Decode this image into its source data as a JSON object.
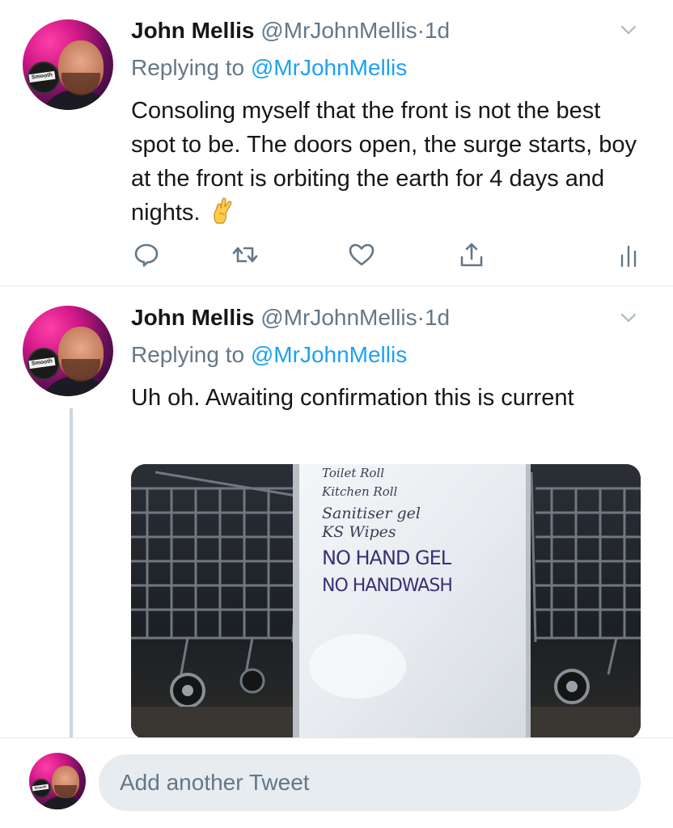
{
  "tweets": [
    {
      "name": "John Mellis",
      "handle": "@MrJohnMellis",
      "separator": "·",
      "time": "1d",
      "replying_prefix": "Replying to ",
      "replying_handle": "@MrJohnMellis",
      "text": "Consoling myself that the front is not the best spot to be. The doors open, the surge starts, boy at the front is orbiting the earth for 4 days and nights.",
      "emoji": "crossed-fingers-icon",
      "avatar_label": "Smooth"
    },
    {
      "name": "John Mellis",
      "handle": "@MrJohnMellis",
      "separator": "·",
      "time": "1d",
      "replying_prefix": "Replying to ",
      "replying_handle": "@MrJohnMellis",
      "text": "Uh oh. Awaiting confirmation this is current",
      "avatar_label": "Smooth",
      "photo": {
        "lines": [
          "Toilet Roll",
          "Kitchen Roll",
          "Sanitiser gel",
          "KS Wipes",
          "NO HAND GEL",
          "NO HANDWASH"
        ]
      }
    }
  ],
  "actions": [
    "reply-icon",
    "retweet-icon",
    "like-icon",
    "share-icon",
    "analytics-icon"
  ],
  "composer": {
    "placeholder": "Add another Tweet",
    "avatar_label": "Smooth"
  },
  "colors": {
    "accent": "#1da1f2",
    "secondary_text": "#657786",
    "thread_line": "#ccd6dd",
    "input_bg": "#e6ecf0"
  }
}
